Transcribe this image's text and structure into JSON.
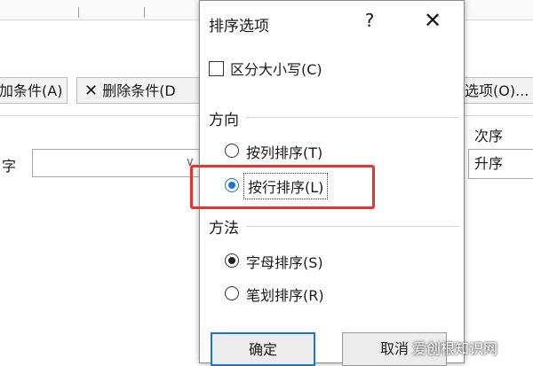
{
  "background": {
    "add_condition_label": "加条件(A)",
    "delete_condition_label": "删除条件(D",
    "options_label": "选项(O)...",
    "sort_by_label": "字",
    "order_header": "次序",
    "order_value": "升序"
  },
  "dialog": {
    "title": "排序选项",
    "help": "?",
    "close": "✕",
    "case_sensitive_label": "区分大小写(C)",
    "direction_title": "方向",
    "direction_options": [
      {
        "label": "按列排序(T)",
        "selected": false
      },
      {
        "label": "按行排序(L)",
        "selected": true
      }
    ],
    "method_title": "方法",
    "method_options": [
      {
        "label": "字母排序(S)",
        "selected": true
      },
      {
        "label": "笔划排序(R)",
        "selected": false
      }
    ],
    "ok_label": "确定",
    "cancel_label": "取消"
  },
  "watermark": "爱创根知识网",
  "colors": {
    "highlight": "#e8332a",
    "accent": "#1e73d6"
  }
}
